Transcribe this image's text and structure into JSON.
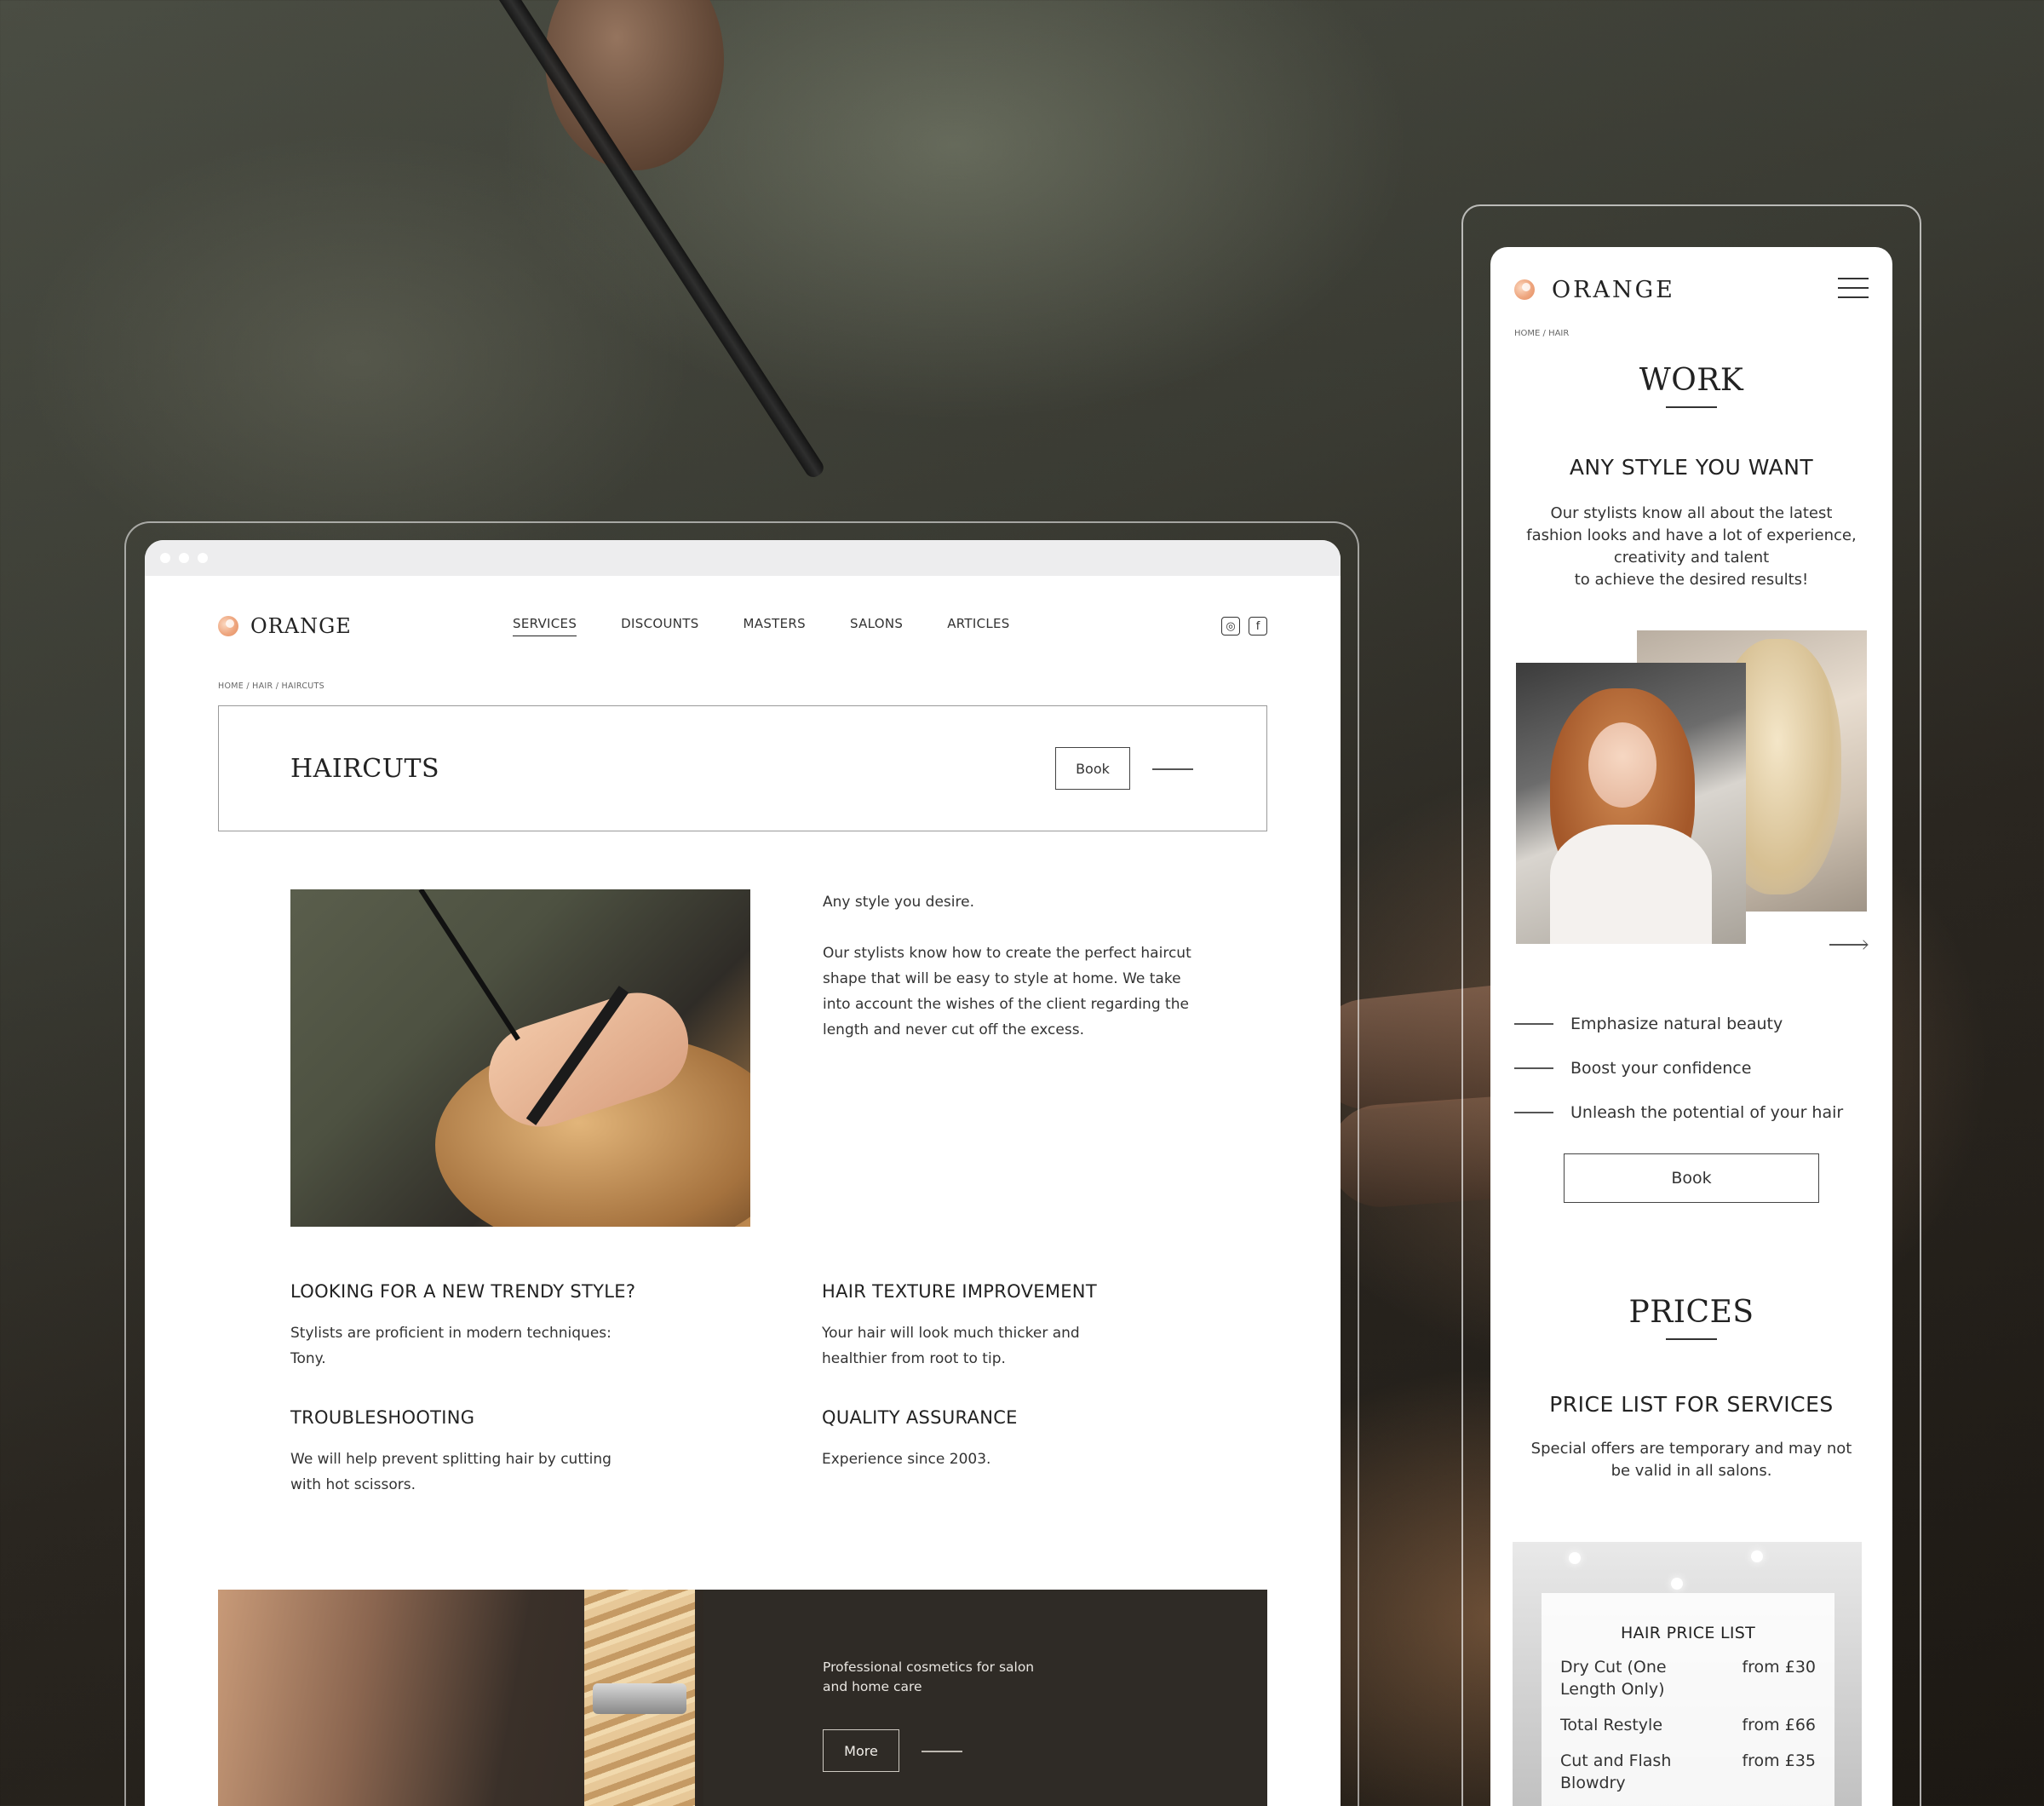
{
  "desktop": {
    "brand": "ORANGE",
    "nav": [
      "SERVICES",
      "DISCOUNTS",
      "MASTERS",
      "SALONS",
      "ARTICLES"
    ],
    "nav_active": "SERVICES",
    "social": {
      "instagram_icon": "instagram-icon",
      "facebook_icon": "facebook-icon"
    },
    "breadcrumb": "HOME / HAIR / HAIRCUTS",
    "hero": {
      "title": "HAIRCUTS",
      "book_label": "Book"
    },
    "intro": {
      "lead": "Any style you desire.",
      "body": "Our stylists know how to create the perfect haircut shape that will be easy to style at home. We take into account the wishes of the client regarding the length and never cut off the excess."
    },
    "features": [
      {
        "title": "LOOKING FOR A NEW TRENDY STYLE?",
        "text": "Stylists are proficient in modern techniques: Tony."
      },
      {
        "title": "HAIR TEXTURE IMPROVEMENT",
        "text": "Your hair will look much thicker and healthier from root to tip."
      },
      {
        "title": "TROUBLESHOOTING",
        "text": "We will help prevent splitting hair by cutting with hot scissors."
      },
      {
        "title": "QUALITY ASSURANCE",
        "text": "Experience since 2003."
      }
    ],
    "banner": {
      "text": "Professional cosmetics for salon and home care",
      "more_label": "More"
    }
  },
  "mobile": {
    "brand": "ORANGE",
    "breadcrumb": "HOME / HAIR",
    "work": {
      "title": "WORK",
      "subtitle": "ANY STYLE YOU WANT",
      "text_1": "Our stylists know all about the latest fashion looks and have a lot of experience, creativity and talent",
      "text_2": "to achieve the desired results!"
    },
    "benefits": [
      "Emphasize natural beauty",
      "Boost your confidence",
      "Unleash the potential of your hair"
    ],
    "book_label": "Book",
    "prices": {
      "title": "PRICES",
      "subtitle": "PRICE LIST FOR SERVICES",
      "text": "Special offers are temporary and may not be valid in all salons.",
      "card_title": "HAIR PRICE LIST",
      "items": [
        {
          "name": "Dry Cut  (One Length Only)",
          "price": "from £30"
        },
        {
          "name": "Total Restyle",
          "price": "from £66"
        },
        {
          "name": "Cut and Flash Blowdry",
          "price": "from £35"
        }
      ]
    }
  },
  "colors": {
    "accent": "#E9976B",
    "text": "#2B2B2B"
  }
}
